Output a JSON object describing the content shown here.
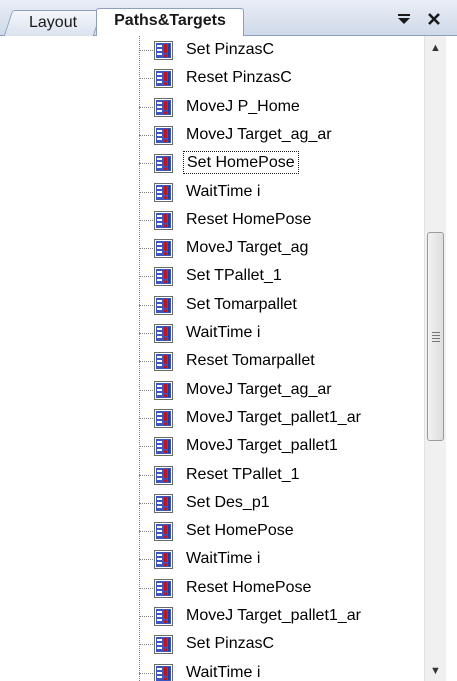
{
  "tabs": [
    {
      "label": "Layout",
      "active": false
    },
    {
      "label": "Paths&Targets",
      "active": true
    }
  ],
  "header": {
    "dropdown_icon": "dropdown-arrow-icon",
    "close_icon": "close-icon"
  },
  "tree": {
    "item_icon": "rapid-instruction-icon",
    "focused_index": 4,
    "items": [
      {
        "label": "Set PinzasC"
      },
      {
        "label": "Reset PinzasC"
      },
      {
        "label": "MoveJ P_Home"
      },
      {
        "label": "MoveJ Target_ag_ar"
      },
      {
        "label": "Set HomePose"
      },
      {
        "label": "WaitTime i"
      },
      {
        "label": "Reset HomePose"
      },
      {
        "label": "MoveJ Target_ag"
      },
      {
        "label": "Set TPallet_1"
      },
      {
        "label": "Set Tomarpallet"
      },
      {
        "label": "WaitTime i"
      },
      {
        "label": "Reset Tomarpallet"
      },
      {
        "label": "MoveJ Target_ag_ar"
      },
      {
        "label": "MoveJ Target_pallet1_ar"
      },
      {
        "label": "MoveJ Target_pallet1"
      },
      {
        "label": "Reset TPallet_1"
      },
      {
        "label": "Set Des_p1"
      },
      {
        "label": "Set HomePose"
      },
      {
        "label": "WaitTime i"
      },
      {
        "label": "Reset HomePose"
      },
      {
        "label": "MoveJ Target_pallet1_ar"
      },
      {
        "label": "Set PinzasC"
      },
      {
        "label": "WaitTime i"
      }
    ]
  },
  "scrollbar": {
    "up_icon": "scroll-up-icon",
    "down_icon": "scroll-down-icon",
    "thumb_start_fraction": 0.29,
    "thumb_size_fraction": 0.33
  },
  "colors": {
    "tab_border": "#8c9fbd",
    "tree_line": "#808080",
    "icon_blue": "#1f3fa8",
    "icon_red": "#c0141a"
  }
}
